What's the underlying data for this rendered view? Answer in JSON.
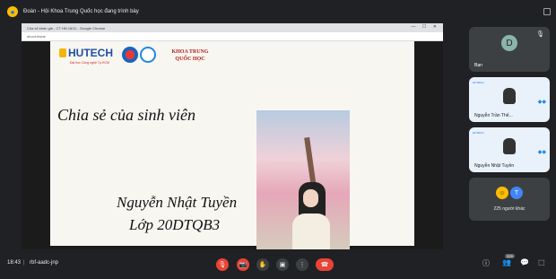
{
  "window": {
    "title": "Đoàn - Hội Khoa Trung Quốc học đang trình bày"
  },
  "browser": {
    "tab_title": "Của sổ khán giả - CT HN 16/11 - Google Chrome",
    "address": "about:blank",
    "window_buttons": "— ☐ ✕"
  },
  "slide": {
    "brand": "HUTECH",
    "brand_sub": "Đại học Công nghệ Tp.HCM",
    "faculty": "KHOA TRUNG QUỐC HỌC",
    "heading": "Chia sẻ của sinh viên",
    "student_name": "Nguyễn Nhật Tuyền",
    "student_class": "Lớp 20DTQB3"
  },
  "participants": {
    "self": {
      "initial": "D",
      "name": "Bạn"
    },
    "tile1": {
      "name": "Nguyễn Trần Thế..."
    },
    "tile2": {
      "name": "Nguyễn Nhật Tuyền"
    },
    "others": {
      "initial": "T",
      "label": "225 người khác"
    }
  },
  "toolbar": {
    "time": "18:43",
    "meeting_code": "rbf-aadc-jnp",
    "participant_count": "229"
  },
  "icons": {
    "mic_off": "🎙",
    "camera_off": "📷",
    "raise_hand": "✋",
    "present": "▣",
    "more": "⋮",
    "hangup": "☎",
    "info": "ⓘ",
    "people": "👥",
    "chat": "💬",
    "activities": "⬚"
  }
}
